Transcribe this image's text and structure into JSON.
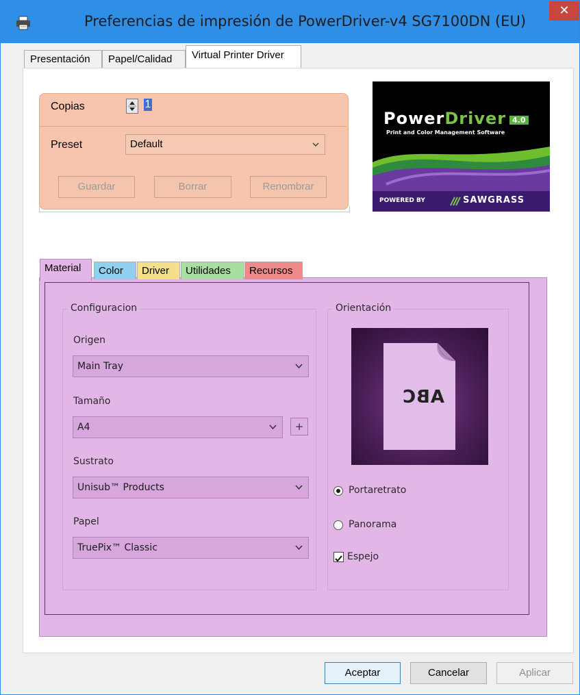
{
  "window": {
    "title": "Preferencias de impresión de PowerDriver-v4 SG7100DN (EU)",
    "close_glyph": "✕"
  },
  "tabs": [
    {
      "label": "Presentación",
      "active": false
    },
    {
      "label": "Papel/Calidad",
      "active": false
    },
    {
      "label": "Virtual Printer Driver",
      "active": true
    }
  ],
  "copies": {
    "label": "Copias",
    "value": "1"
  },
  "preset": {
    "label": "Preset",
    "value": "Default"
  },
  "preset_buttons": {
    "save": "Guardar",
    "delete": "Borrar",
    "rename": "Renombrar"
  },
  "logo": {
    "brand_a": "Power",
    "brand_b": "Driver",
    "version": "4.0",
    "tagline": "Print and Color Management Software",
    "powered_by": "POWERED BY",
    "company": "SAWGRASS"
  },
  "subtabs": [
    {
      "label": "Material",
      "color": "#e2b6e6"
    },
    {
      "label": "Color",
      "color": "#8fd0ee"
    },
    {
      "label": "Driver",
      "color": "#f5e08a"
    },
    {
      "label": "Utilidades",
      "color": "#a8dfa0"
    },
    {
      "label": "Recursos",
      "color": "#f08a8a"
    }
  ],
  "configuracion": {
    "title": "Configuracion",
    "origen_label": "Origen",
    "origen_value": "Main Tray",
    "tamano_label": "Tamaño",
    "tamano_value": "A4",
    "plus_glyph": "+",
    "sustrato_label": "Sustrato",
    "sustrato_value": "Unisub™ Products",
    "papel_label": "Papel",
    "papel_value": "TruePix™ Classic"
  },
  "orientacion": {
    "title": "Orientación",
    "preview_text": "ABC",
    "portrait_label": "Portaretrato",
    "landscape_label": "Panorama",
    "mirror_label": "Espejo",
    "portrait_selected": true,
    "mirror_checked": true
  },
  "dialog_buttons": {
    "ok": "Aceptar",
    "cancel": "Cancelar",
    "apply": "Aplicar"
  },
  "colors": {
    "titlebar": "#2f8fe6",
    "close": "#c7473e",
    "copy_panel": "#f7c4ad",
    "material_panel": "#e2b6e6"
  }
}
